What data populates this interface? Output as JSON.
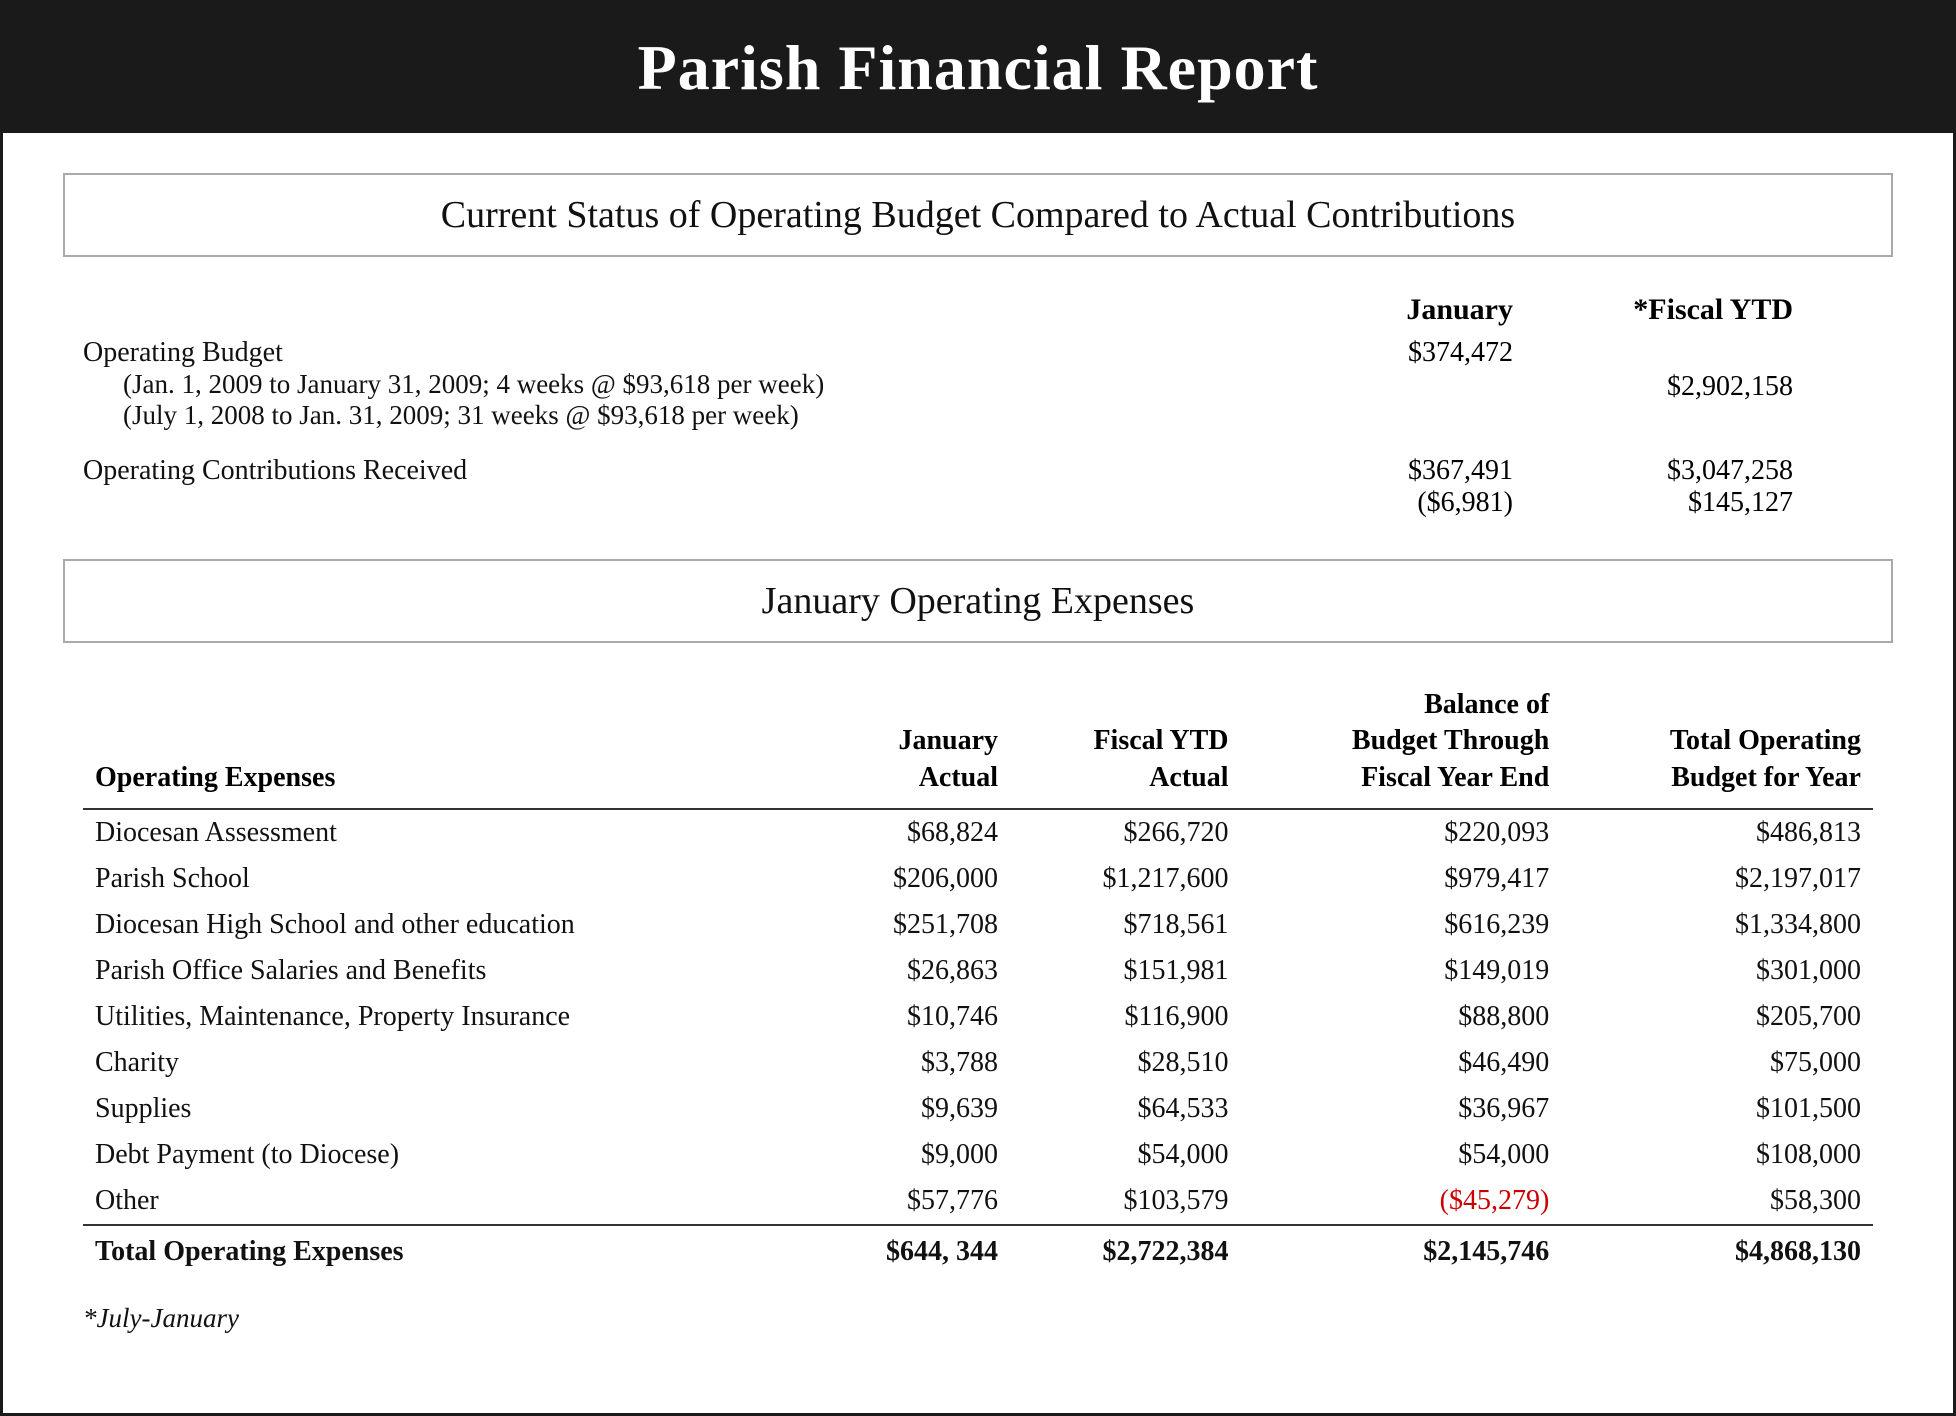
{
  "header": {
    "title": "Parish Financial Report"
  },
  "operating_budget_section": {
    "box_title": "Current Status of Operating Budget Compared to Actual Contributions",
    "col_january": "January",
    "col_fiscal_ytd": "*Fiscal YTD",
    "operating_budget_label": "Operating Budget",
    "jan_detail_1": "(Jan. 1, 2009 to January 31, 2009; 4 weeks @ $93,618 per week)",
    "jan_value_1": "$374,472",
    "jan_detail_2": "(July 1, 2008 to Jan. 31, 2009; 31 weeks @ $93,618 per week)",
    "fiscal_value_2": "$2,902,158",
    "contributions_label": "Operating Contributions Received",
    "contributions_jan": "$367,491",
    "contributions_jan_diff": "($6,981)",
    "contributions_fiscal": "$3,047,258",
    "contributions_fiscal_diff": "$145,127"
  },
  "expenses_section": {
    "box_title": "January Operating Expenses",
    "columns": {
      "label": "Operating Expenses",
      "jan_actual": "January\nActual",
      "fiscal_ytd": "Fiscal YTD\nActual",
      "balance": "Balance of\nBudget Through\nFiscal Year End",
      "total_budget": "Total Operating\nBudget for Year"
    },
    "rows": [
      {
        "label": "Diocesan Assessment",
        "jan_actual": "$68,824",
        "fiscal_ytd": "$266,720",
        "balance": "$220,093",
        "total_budget": "$486,813",
        "balance_red": false
      },
      {
        "label": "Parish School",
        "jan_actual": "$206,000",
        "fiscal_ytd": "$1,217,600",
        "balance": "$979,417",
        "total_budget": "$2,197,017",
        "balance_red": false
      },
      {
        "label": "Diocesan High School and other education",
        "jan_actual": "$251,708",
        "fiscal_ytd": "$718,561",
        "balance": "$616,239",
        "total_budget": "$1,334,800",
        "balance_red": false
      },
      {
        "label": "Parish Office Salaries and Benefits",
        "jan_actual": "$26,863",
        "fiscal_ytd": "$151,981",
        "balance": "$149,019",
        "total_budget": "$301,000",
        "balance_red": false
      },
      {
        "label": "Utilities, Maintenance, Property Insurance",
        "jan_actual": "$10,746",
        "fiscal_ytd": "$116,900",
        "balance": "$88,800",
        "total_budget": "$205,700",
        "balance_red": false
      },
      {
        "label": "Charity",
        "jan_actual": "$3,788",
        "fiscal_ytd": "$28,510",
        "balance": "$46,490",
        "total_budget": "$75,000",
        "balance_red": false
      },
      {
        "label": "Supplies",
        "jan_actual": "$9,639",
        "fiscal_ytd": "$64,533",
        "balance": "$36,967",
        "total_budget": "$101,500",
        "balance_red": false
      },
      {
        "label": "Debt Payment (to Diocese)",
        "jan_actual": "$9,000",
        "fiscal_ytd": "$54,000",
        "balance": "$54,000",
        "total_budget": "$108,000",
        "balance_red": false
      },
      {
        "label": "Other",
        "jan_actual": "$57,776",
        "fiscal_ytd": "$103,579",
        "balance": "($45,279)",
        "total_budget": "$58,300",
        "balance_red": true
      }
    ],
    "total_row": {
      "label": "Total Operating Expenses",
      "jan_actual": "$644, 344",
      "fiscal_ytd": "$2,722,384",
      "balance": "$2,145,746",
      "total_budget": "$4,868,130"
    },
    "footnote": "*July-January"
  }
}
